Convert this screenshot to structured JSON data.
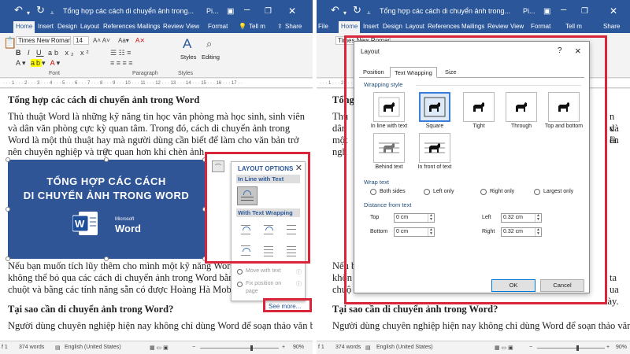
{
  "left": {
    "title": "Tổng hợp các cách di chuyển ảnh trong...",
    "window_abbrev": "Pi...",
    "tabs": [
      "Home",
      "Insert",
      "Design",
      "Layout",
      "References",
      "Mailings",
      "Review",
      "View",
      "Format"
    ],
    "tell_me": "Tell m",
    "share": "Share",
    "font_name": "Times New Roman",
    "font_size": "14",
    "groups": {
      "font": "Font",
      "paragraph": "Paragraph",
      "styles": "Styles"
    },
    "styles_btn": "Styles",
    "editing_btn": "Editing",
    "heading1": "Tổng hợp các cách di chuyển ảnh trong Word",
    "para1": "Thủ thuật Word là những kỹ năng tin học văn phòng mà học sinh, sinh viên và dân văn phòng cực kỳ quan tâm. Trong đó, cách di chuyển ảnh trong Word là một thủ thuật hay mà người dùng cần biết để làm cho văn bản trở nên chuyên nghiệp và trực quan hơn khi chèn ảnh.",
    "banner_line1": "TỔNG HỢP CÁC CÁCH",
    "banner_line2": "DI CHUYỂN ẢNH TRONG WORD",
    "banner_ms": "Microsoft",
    "banner_word": "Word",
    "para2a": "Nếu bạn muốn tích lũy thêm cho mình một kỹ năng Word bổ íc",
    "para2b": "không thể bỏ qua các cách di chuyển ảnh trong Word bằng bàn",
    "para2c": "chuột và bằng các tính năng sẵn có được Hoàng Hà Mobile tổn",
    "heading2": "Tại sao cần di chuyển ảnh trong Word?",
    "para3": "Người dùng chuyên nghiệp hiện nay không chỉ dùng Word để soạn thảo văn bản",
    "layout_options": {
      "title": "LAYOUT OPTIONS",
      "inline": "In Line with Text",
      "wrapping": "With Text Wrapping",
      "move_with_text": "Move with text",
      "fix_position": "Fix position on page",
      "see_more": "See more..."
    },
    "status": {
      "page": "f 1",
      "words": "374 words",
      "lang": "English (United States)",
      "zoom": "90%"
    }
  },
  "right": {
    "title": "Tổng hợp các cách di chuyển ảnh trong...",
    "window_abbrev": "Pi...",
    "tabs": [
      "File",
      "Home",
      "Insert",
      "Design",
      "Layout",
      "References",
      "Mailings",
      "Review",
      "View",
      "Format"
    ],
    "tell_me": "Tell m",
    "share": "Share",
    "font_name": "Times New Roman",
    "bg_text": {
      "h1": "Tổng",
      "p1": [
        "Thủ",
        "dân",
        "một",
        "ngh"
      ],
      "right_frag": [
        "n và",
        "d là",
        "ên"
      ],
      "bottom1": "Nếu b",
      "bottom1r": "ta",
      "bottom2": "khôn",
      "bottom2r": "ua",
      "bottom3": "chuộ",
      "bottom3r": "lày.",
      "h2": "Tại sao cần di chuyển ảnh trong Word?",
      "p3": "Người dùng chuyên nghiệp hiện nay không chỉ dùng Word để soạn thảo văn bản"
    },
    "dialog": {
      "title": "Layout",
      "help": "?",
      "close": "×",
      "tabs": [
        "Position",
        "Text Wrapping",
        "Size"
      ],
      "wrapping_style": "Wrapping style",
      "styles": [
        "In line with text",
        "Square",
        "Tight",
        "Through",
        "Top and bottom",
        "Behind text",
        "In front of text"
      ],
      "wrap_text": "Wrap text",
      "wrap_options": [
        "Both sides",
        "Left only",
        "Right only",
        "Largest only"
      ],
      "distance": "Distance from text",
      "top_label": "Top",
      "top_val": "0 cm",
      "bottom_label": "Bottom",
      "bottom_val": "0 cm",
      "left_label": "Left",
      "left_val": "0.32 cm",
      "right_label": "Right",
      "right_val": "0.32 cm",
      "ok": "OK",
      "cancel": "Cancel"
    },
    "status": {
      "page": "f 1",
      "words": "374 words",
      "lang": "English (United States)",
      "zoom": "90%"
    }
  },
  "colors": {
    "brand": "#2b579a",
    "highlight": "#d9263a",
    "banner": "#2f5597"
  }
}
